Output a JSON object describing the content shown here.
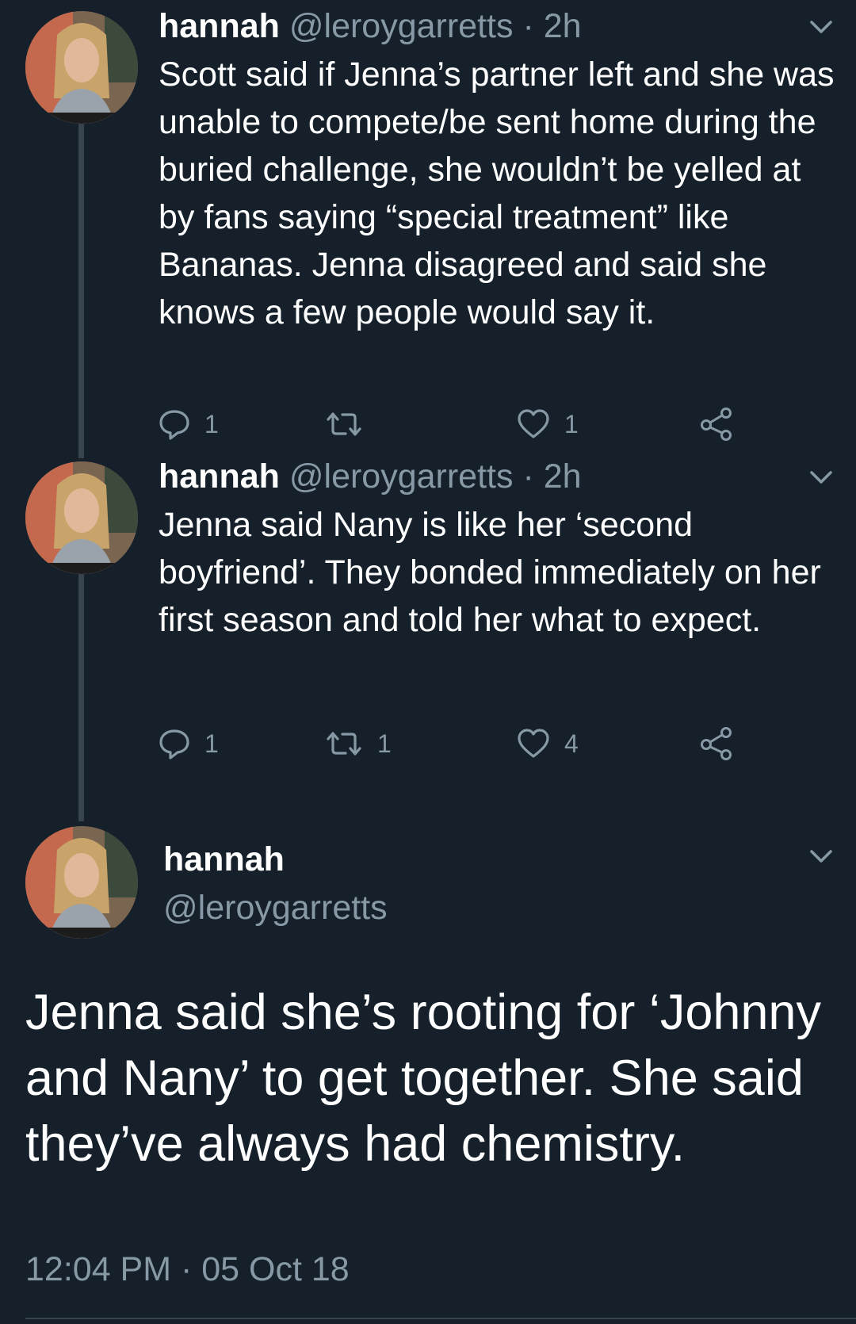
{
  "tweets": [
    {
      "name": "hannah",
      "handle": "@leroygarretts",
      "separator": "·",
      "time": "2h",
      "text": "Scott said if Jenna’s partner left and she was unable to compete/be sent home during the buried challenge, she wouldn’t be yelled at by fans saying “special treatment” like Bananas. Jenna disagreed and said she knows a few people would say it.",
      "reply_count": "1",
      "retweet_count": "",
      "like_count": "1"
    },
    {
      "name": "hannah",
      "handle": "@leroygarretts",
      "separator": "·",
      "time": "2h",
      "text": "Jenna said Nany is like her ‘second boyfriend’. They bonded immediately on her first season and told her what to expect.",
      "reply_count": "1",
      "retweet_count": "1",
      "like_count": "4"
    }
  ],
  "main_tweet": {
    "name": "hannah",
    "handle": "@leroygarretts",
    "text": "Jenna said she’s rooting for ‘Johnny and Nany’ to get together. She said they’ve always had chemistry.",
    "timestamp": "12:04 PM · 05 Oct 18"
  },
  "icons": {
    "reply": "reply-icon",
    "retweet": "retweet-icon",
    "like": "heart-icon",
    "share": "share-icon",
    "menu": "chevron-down-icon"
  },
  "colors": {
    "background": "#15202b",
    "primary_text": "#ffffff",
    "secondary_text": "#8899a6",
    "thread_line": "#38444d"
  }
}
